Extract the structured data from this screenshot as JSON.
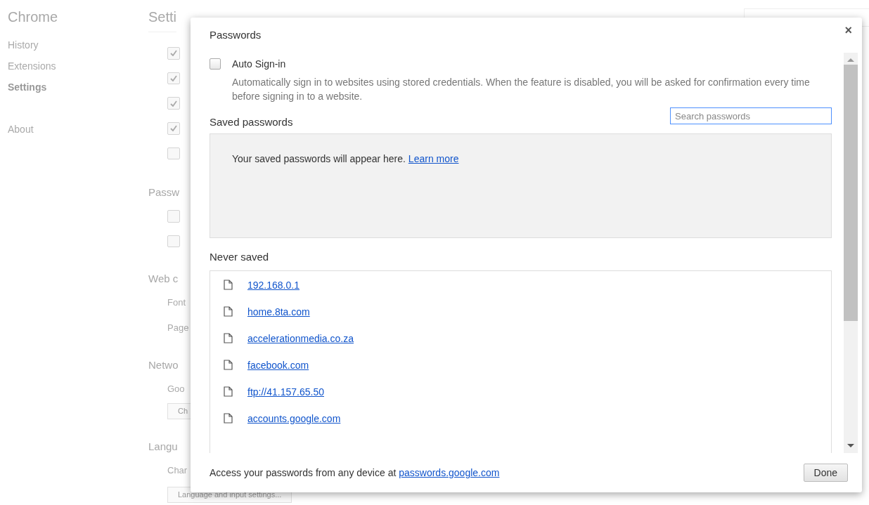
{
  "background": {
    "app_title": "Chrome",
    "sidebar": [
      {
        "label": "History",
        "selected": false
      },
      {
        "label": "Extensions",
        "selected": false
      },
      {
        "label": "Settings",
        "selected": true
      },
      {
        "label": "About",
        "selected": false
      }
    ],
    "heading": "Setti",
    "checkboxes": [
      {
        "checked": true
      },
      {
        "checked": true
      },
      {
        "checked": true
      },
      {
        "checked": true
      },
      {
        "checked": false
      }
    ],
    "sections": [
      {
        "title": "Passw",
        "items": [
          {
            "kind": "checkbox",
            "checked": false
          },
          {
            "kind": "checkbox",
            "checked": false
          }
        ]
      },
      {
        "title": "Web c",
        "items": [
          {
            "kind": "text",
            "label": "Font"
          },
          {
            "kind": "text",
            "label": "Page"
          }
        ]
      },
      {
        "title": "Netwo",
        "items": [
          {
            "kind": "text",
            "label": "Goo"
          },
          {
            "kind": "button",
            "label": "Ch"
          }
        ]
      },
      {
        "title": "Langu",
        "items": [
          {
            "kind": "text",
            "label": "Char"
          },
          {
            "kind": "button",
            "label": "Language and input settings..."
          }
        ]
      }
    ]
  },
  "dialog": {
    "title": "Passwords",
    "close": "×",
    "auto_signin": {
      "label": "Auto Sign-in",
      "checked": false,
      "description": "Automatically sign in to websites using stored credentials. When the feature is disabled, you will be asked for confirmation every time before signing in to a website."
    },
    "saved": {
      "title": "Saved passwords",
      "search_placeholder": "Search passwords",
      "empty_text": "Your saved passwords will appear here.",
      "learn_more": "Learn more"
    },
    "never_saved": {
      "title": "Never saved",
      "sites": [
        "192.168.0.1",
        "home.8ta.com",
        "accelerationmedia.co.za",
        "facebook.com",
        "ftp://41.157.65.50",
        "accounts.google.com"
      ]
    },
    "footer": {
      "text": "Access your passwords from any device at",
      "link": "passwords.google.com",
      "button": "Done"
    }
  }
}
